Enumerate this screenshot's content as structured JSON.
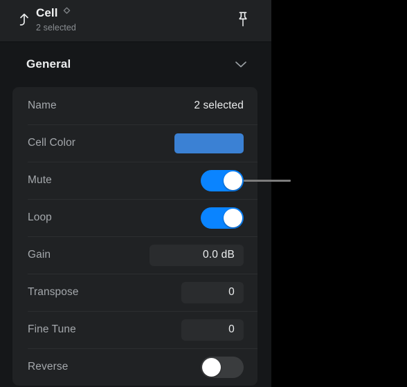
{
  "header": {
    "back_icon": "arrow-up-back-icon",
    "title": "Cell",
    "title_badge_icon": "diamond-stepper-icon",
    "subtitle": "2 selected",
    "pin_icon": "pushpin-icon"
  },
  "section": {
    "title": "General",
    "chevron_icon": "chevron-down-icon",
    "expanded": true
  },
  "properties": [
    {
      "label": "Name",
      "type": "text",
      "value": "2 selected"
    },
    {
      "label": "Cell Color",
      "type": "color",
      "value": "#3b81d4"
    },
    {
      "label": "Mute",
      "type": "toggle",
      "value": "on"
    },
    {
      "label": "Loop",
      "type": "toggle",
      "value": "on"
    },
    {
      "label": "Gain",
      "type": "field",
      "value": "0.0 dB"
    },
    {
      "label": "Transpose",
      "type": "field",
      "value": "0"
    },
    {
      "label": "Fine Tune",
      "type": "field",
      "value": "0"
    },
    {
      "label": "Reverse",
      "type": "toggle",
      "value": "off"
    }
  ],
  "colors": {
    "panel_background": "#151719",
    "header_background": "#202224",
    "card_background": "#202224",
    "field_background": "#2a2c2e",
    "toggle_on": "#0a84ff",
    "toggle_off": "#3a3c3e",
    "swatch_blue": "#3b81d4",
    "label_text": "#a4a8ac",
    "value_text": "#e9ebec",
    "leader_line": "#7c7c7c",
    "outside_background": "#000000"
  },
  "annotation": {
    "leader_line_target": "Mute"
  }
}
